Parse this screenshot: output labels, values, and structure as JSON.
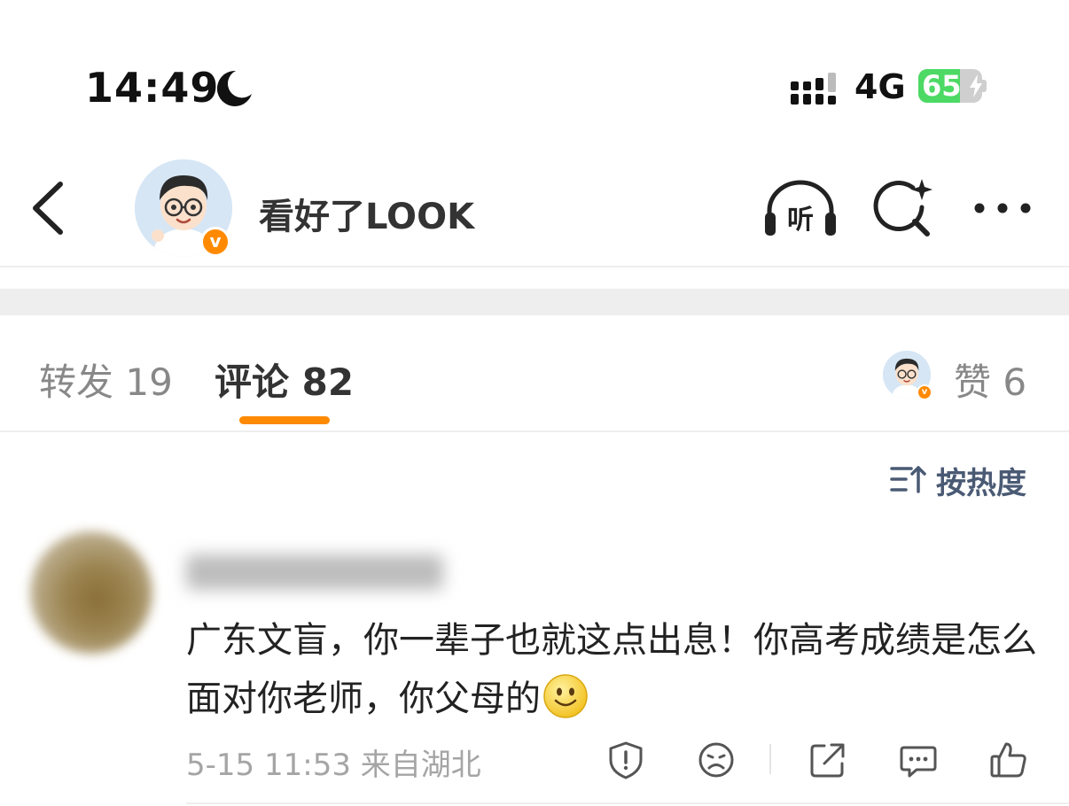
{
  "status_bar": {
    "time": "14:49",
    "network": "4G",
    "battery": "65",
    "battery_level": 0.65,
    "battery_color": "#4cd964"
  },
  "header": {
    "back_icon": "chevron-left-icon",
    "title": "看好了LOOK",
    "icons": [
      "listen-icon",
      "search-sparkle-icon",
      "more-icon"
    ],
    "listen_glyph": "听",
    "verified_glyph": "v"
  },
  "tabs": {
    "repost": "转发 19",
    "comment": "评论 82",
    "likes": "赞 6",
    "accent": "#ff8a00"
  },
  "sort": {
    "label": "按热度",
    "icon": "sort-icon"
  },
  "comment": {
    "text": "广东文盲，你一辈子也就这点出息！你高考成绩是怎么面对你老师，你父母的",
    "emoji": "smile-emoji",
    "meta": "5-15 11:53 来自湖北",
    "actions": [
      "report-icon",
      "dislike-icon",
      "share-icon",
      "reply-icon",
      "like-icon"
    ]
  }
}
